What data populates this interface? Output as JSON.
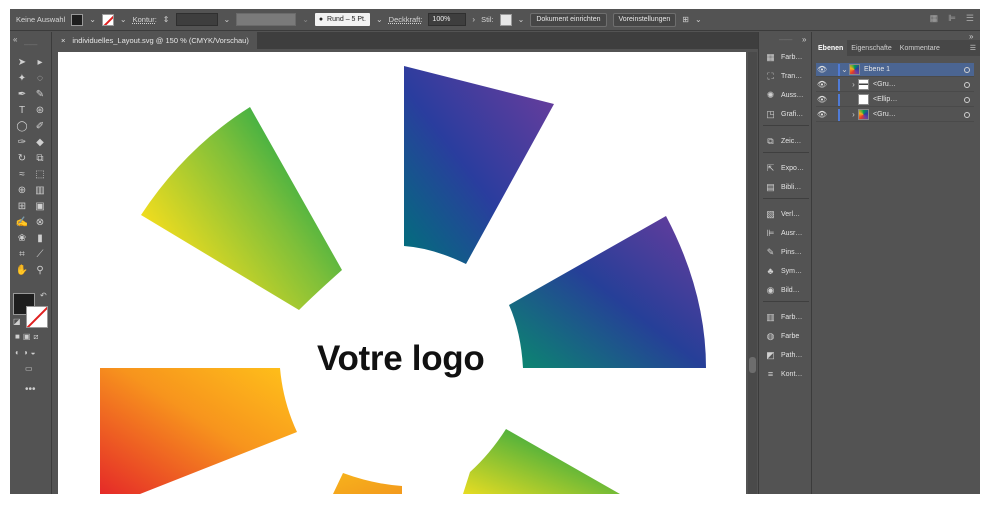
{
  "control_bar": {
    "selection_label": "Keine Auswahl",
    "kontur_label": "Kontur:",
    "brush_label": "Rund – 5 Pt.",
    "opacity_label": "Deckkraft:",
    "opacity_value": "100%",
    "style_label": "Stil:",
    "setup_button": "Dokument einrichten",
    "prefs_button": "Voreinstellungen"
  },
  "document": {
    "tab_title": "individuelles_Layout.svg @ 150 % (CMYK/Vorschau)",
    "close_glyph": "×",
    "logo_text": "Votre logo"
  },
  "mid_panel": {
    "items": [
      "Farb…",
      "Tran…",
      "Auss…",
      "Grafi…",
      "Zeic…",
      "Expo…",
      "Bibli…",
      "Verl…",
      "Ausr…",
      "Pins…",
      "Sym…",
      "Bild…",
      "Farb…",
      "Farbe",
      "Path…",
      "Kont…"
    ]
  },
  "layers_panel": {
    "tabs": [
      "Ebenen",
      "Eigenschafte",
      "Kommentare"
    ],
    "rows": [
      {
        "label": "Ebene 1",
        "selected": true
      },
      {
        "label": "<Gru…",
        "selected": false
      },
      {
        "label": "<Ellip…",
        "selected": false
      },
      {
        "label": "<Gru…",
        "selected": false
      }
    ]
  },
  "colors": {
    "ui_bg": "#535353",
    "selection": "#4b6592",
    "layer_color": "#4f7bd6",
    "accent_red": "#e02020"
  }
}
